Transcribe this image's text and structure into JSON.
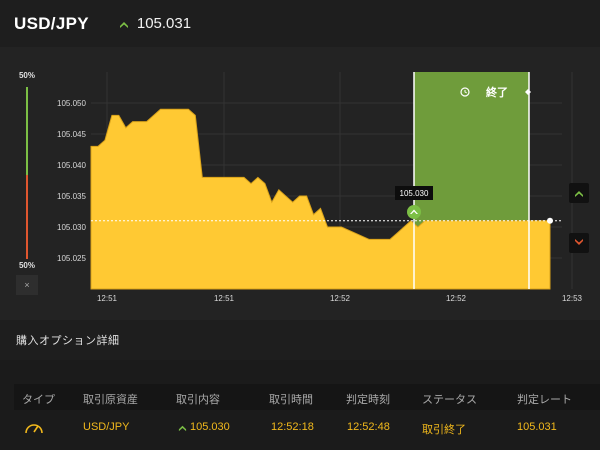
{
  "header": {
    "pair": "USD/JPY",
    "rate": "105.031",
    "rate_arrow_icon": "up-arrow-icon",
    "accent_up": "#7cbf45"
  },
  "gauge": {
    "top_label": "50%",
    "bottom_label": "50%",
    "close_label": "×"
  },
  "chart": {
    "price_tooltip": "105.030",
    "expiry_label": "終了",
    "expiry_icon": "history-icon",
    "up_button_icon": "up-arrow-icon",
    "down_button_icon": "down-arrow-icon",
    "colors": {
      "area": "#ffc933",
      "expiry_zone": "#6f9c3b",
      "grid": "#3a3a3a"
    }
  },
  "chart_data": {
    "type": "area",
    "y_tick_labels": [
      "105.050",
      "105.045",
      "105.040",
      "105.035",
      "105.030",
      "105.025"
    ],
    "x_tick_labels": [
      "12:51",
      "12:51",
      "12:52",
      "12:52",
      "12:53"
    ],
    "ylim": [
      105.02,
      105.055
    ],
    "current_rate": 105.031,
    "entry_rate": 105.03,
    "x": [
      0,
      0.5,
      1,
      1.5,
      2,
      2.5,
      3,
      3.5,
      4,
      5,
      6,
      7,
      7.5,
      8,
      8.5,
      9,
      10,
      11,
      11.5,
      12,
      12.5,
      13,
      13.5,
      14,
      14.5,
      15,
      15.5,
      16,
      16.5,
      17,
      17.5,
      18,
      19,
      20,
      21,
      21.5,
      22,
      22.5,
      23,
      23.5,
      24,
      24.5,
      25,
      25.5,
      26,
      26.5,
      27,
      28,
      29,
      30,
      31,
      32,
      33
    ],
    "values": [
      105.043,
      105.043,
      105.044,
      105.048,
      105.048,
      105.046,
      105.047,
      105.047,
      105.047,
      105.049,
      105.049,
      105.049,
      105.048,
      105.038,
      105.038,
      105.038,
      105.038,
      105.038,
      105.037,
      105.038,
      105.037,
      105.034,
      105.036,
      105.035,
      105.034,
      105.035,
      105.035,
      105.032,
      105.033,
      105.03,
      105.03,
      105.03,
      105.029,
      105.028,
      105.028,
      105.028,
      105.029,
      105.03,
      105.031,
      105.03,
      105.031,
      105.031,
      105.031,
      105.031,
      105.031,
      105.031,
      105.031,
      105.031,
      105.031,
      105.031,
      105.031,
      105.031,
      105.031
    ]
  },
  "details": {
    "section_title": "購入オプション詳細",
    "columns": [
      "タイプ",
      "取引原資産",
      "取引内容",
      "取引時間",
      "判定時刻",
      "ステータス",
      "判定レート"
    ],
    "row": {
      "type_icon": "gauge-icon",
      "asset": "USD/JPY",
      "direction_icon": "up-arrow-icon",
      "content": "105.030",
      "trade_time": "12:52:18",
      "judge_time": "12:52:48",
      "status": "取引終了",
      "judge_rate": "105.031"
    }
  }
}
